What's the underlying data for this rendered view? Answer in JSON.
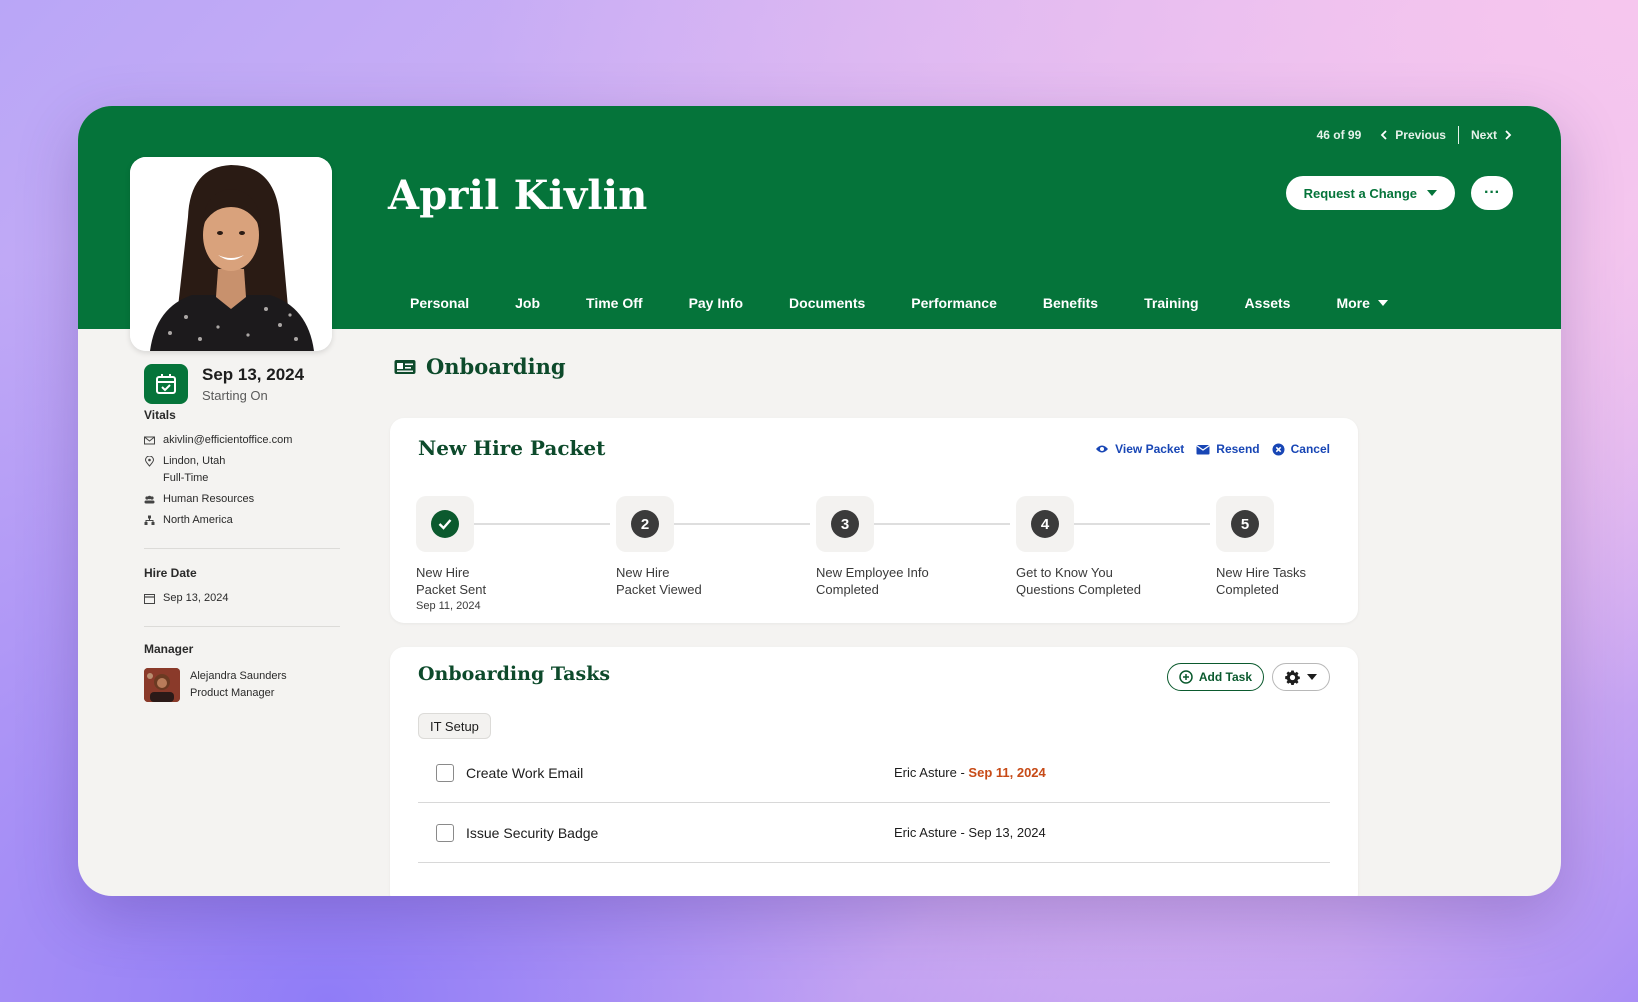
{
  "pager": {
    "count": "46 of 99",
    "previous": "Previous",
    "next": "Next"
  },
  "employee": {
    "name": "April Kivlin"
  },
  "header_actions": {
    "request_change": "Request a Change",
    "more": "···"
  },
  "tabs": [
    {
      "label": "Personal"
    },
    {
      "label": "Job"
    },
    {
      "label": "Time Off"
    },
    {
      "label": "Pay Info"
    },
    {
      "label": "Documents"
    },
    {
      "label": "Performance"
    },
    {
      "label": "Benefits"
    },
    {
      "label": "Training"
    },
    {
      "label": "Assets"
    },
    {
      "label": "More"
    }
  ],
  "start": {
    "date": "Sep 13, 2024",
    "label": "Starting On"
  },
  "vitals": {
    "title": "Vitals",
    "email": "akivlin@efficientoffice.com",
    "location": "Lindon, Utah",
    "employment_type": "Full-Time",
    "department": "Human Resources",
    "division": "North America"
  },
  "hire_date": {
    "title": "Hire Date",
    "value": "Sep 13, 2024"
  },
  "manager": {
    "title": "Manager",
    "name": "Alejandra Saunders",
    "role": "Product Manager"
  },
  "section": {
    "title": "Onboarding"
  },
  "packet": {
    "title": "New Hire Packet",
    "actions": {
      "view": "View Packet",
      "resend": "Resend",
      "cancel": "Cancel"
    },
    "steps": [
      {
        "number": "",
        "line1": "New Hire",
        "line2": "Packet Sent",
        "date": "Sep 11, 2024",
        "done": true
      },
      {
        "number": "2",
        "line1": "New Hire",
        "line2": "Packet Viewed",
        "date": "",
        "done": false
      },
      {
        "number": "3",
        "line1": "New Employee Info",
        "line2": "Completed",
        "date": "",
        "done": false
      },
      {
        "number": "4",
        "line1": "Get to Know You",
        "line2": "Questions Completed",
        "date": "",
        "done": false
      },
      {
        "number": "5",
        "line1": "New Hire Tasks",
        "line2": "Completed",
        "date": "",
        "done": false
      }
    ]
  },
  "tasks": {
    "title": "Onboarding Tasks",
    "add_task": "Add Task",
    "category": "IT Setup",
    "items": [
      {
        "name": "Create Work Email",
        "assignee": "Eric Asture - ",
        "due": "Sep 11, 2024",
        "overdue": true
      },
      {
        "name": "Issue Security Badge",
        "assignee": "Eric Asture - ",
        "due": "Sep 13, 2024",
        "overdue": false
      }
    ]
  },
  "colors": {
    "brand_green": "#05743a",
    "link_blue": "#1846b5",
    "overdue": "#c74a16"
  }
}
